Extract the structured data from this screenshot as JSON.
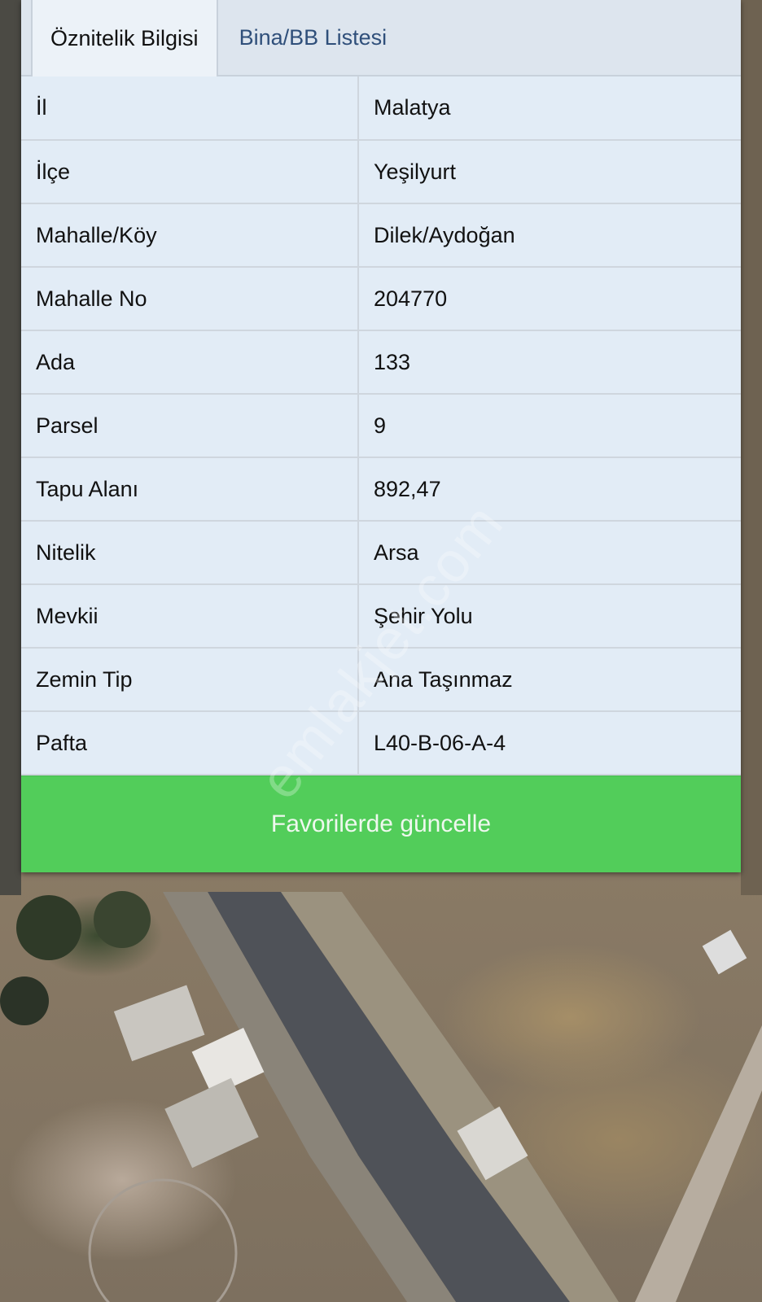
{
  "tabs": [
    {
      "label": "Öznitelik Bilgisi",
      "active": true
    },
    {
      "label": "Bina/BB Listesi",
      "active": false
    }
  ],
  "attributes": [
    {
      "key": "İl",
      "value": "Malatya"
    },
    {
      "key": "İlçe",
      "value": "Yeşilyurt"
    },
    {
      "key": "Mahalle/Köy",
      "value": "Dilek/Aydoğan"
    },
    {
      "key": "Mahalle No",
      "value": "204770"
    },
    {
      "key": "Ada",
      "value": "133"
    },
    {
      "key": "Parsel",
      "value": "9"
    },
    {
      "key": "Tapu Alanı",
      "value": "892,47"
    },
    {
      "key": "Nitelik",
      "value": "Arsa"
    },
    {
      "key": "Mevkii",
      "value": "Şehir Yolu"
    },
    {
      "key": "Zemin Tip",
      "value": "Ana Taşınmaz"
    },
    {
      "key": "Pafta",
      "value": "L40-B-06-A-4"
    }
  ],
  "favorite_button": {
    "label": "Favorilerde güncelle",
    "color": "#52cd5a"
  },
  "watermark": "emlakjet.com"
}
